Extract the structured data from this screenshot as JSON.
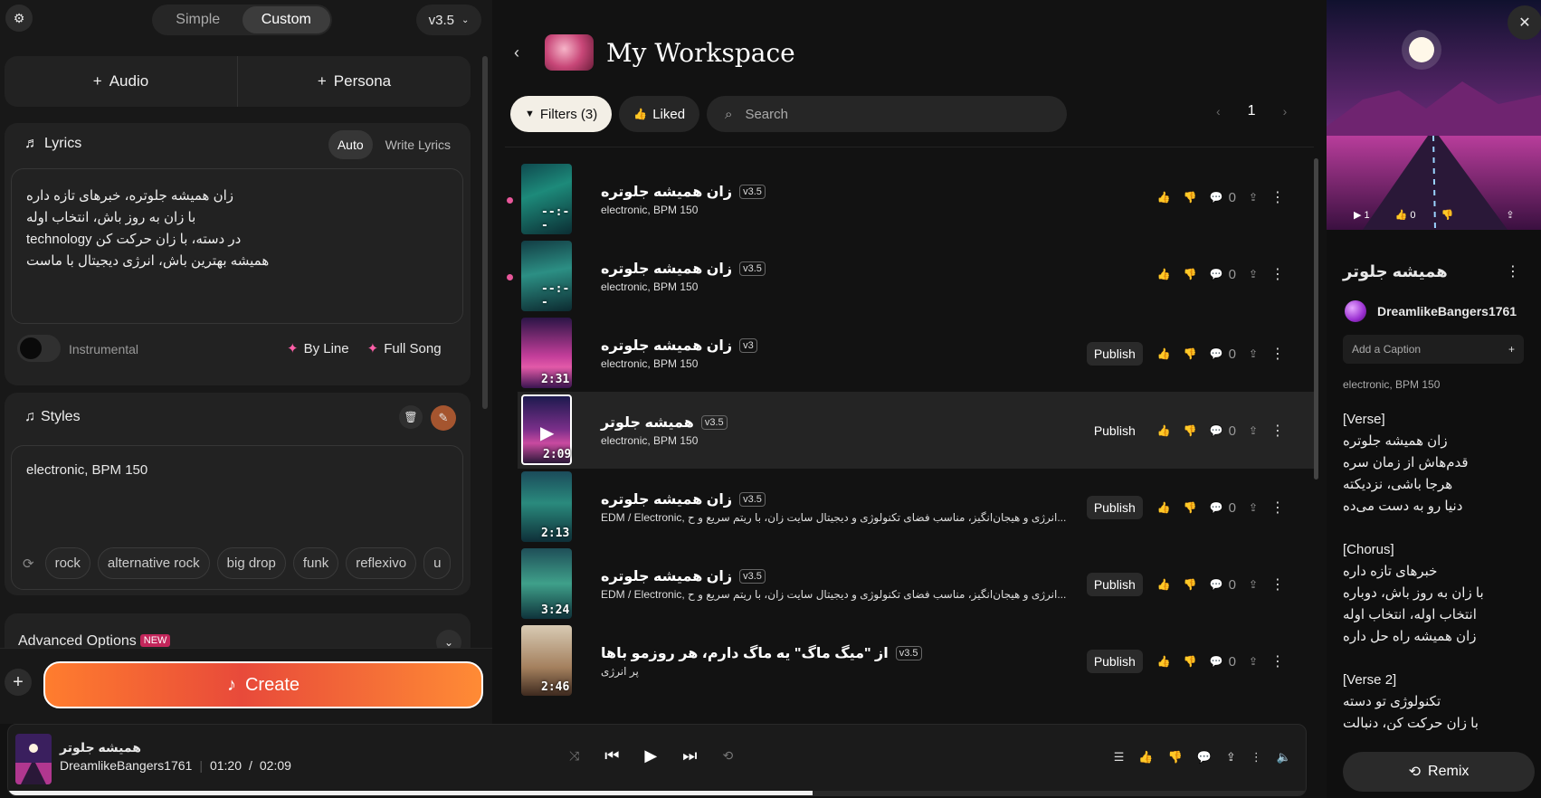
{
  "left": {
    "mode_tabs": [
      "Simple",
      "Custom"
    ],
    "active_mode": "Custom",
    "version": "v3.5",
    "add_audio": "Audio",
    "add_persona": "Persona",
    "lyrics": {
      "title": "Lyrics",
      "tab_auto": "Auto",
      "tab_write": "Write Lyrics",
      "lines": [
        "زان همیشه جلوتره، خبرهای تازه داره",
        "با زان به روز باش، انتخاب اوله",
        "technology در دسته، با زان حرکت کن",
        "همیشه بهترین باش، انرژی دیجیتال با ماست"
      ],
      "instrumental_label": "Instrumental",
      "by_line": "By Line",
      "full_song": "Full Song"
    },
    "styles": {
      "title": "Styles",
      "value": "electronic, BPM 150",
      "tags": [
        "rock",
        "alternative rock",
        "big drop",
        "funk",
        "reflexivo",
        "u"
      ]
    },
    "advanced": {
      "label": "Advanced Options",
      "badge": "NEW"
    },
    "create_label": "Create"
  },
  "center": {
    "title": "My Workspace",
    "filters_label": "Filters (3)",
    "liked_label": "Liked",
    "search_placeholder": "Search",
    "page": "1",
    "tracks": [
      {
        "title": "زان همیشه جلوتره",
        "version": "v3.5",
        "style": "electronic, BPM 150",
        "duration": "--:--",
        "publish": "",
        "comments": "0",
        "new": true,
        "selected": false,
        "art": "city"
      },
      {
        "title": "زان همیشه جلوتره",
        "version": "v3.5",
        "style": "electronic, BPM 150",
        "duration": "--:--",
        "publish": "",
        "comments": "0",
        "new": true,
        "selected": false,
        "art": "city2"
      },
      {
        "title": "زان همیشه جلوتره",
        "version": "v3",
        "style": "electronic, BPM 150",
        "duration": "2:31",
        "publish": "Publish",
        "comments": "0",
        "new": false,
        "selected": false,
        "art": "sunset"
      },
      {
        "title": "همیشه جلوتر",
        "version": "v3.5",
        "style": "electronic, BPM 150",
        "duration": "2:09",
        "publish": "Publish",
        "comments": "0",
        "new": false,
        "selected": true,
        "art": "road"
      },
      {
        "title": "زان همیشه جلوتره",
        "version": "v3.5",
        "style": "EDM / Electronic, انرژی و هیجان‌انگیز، مناسب فضای تکنولوژی و دیجیتال سایت زان، با ریتم سریع و ح...",
        "duration": "2:13",
        "publish": "Publish",
        "comments": "0",
        "new": false,
        "selected": false,
        "art": "skyline"
      },
      {
        "title": "زان همیشه جلوتره",
        "version": "v3.5",
        "style": "EDM / Electronic, انرژی و هیجان‌انگیز، مناسب فضای تکنولوژی و دیجیتال سایت زان، با ریتم سریع و ح...",
        "duration": "3:24",
        "publish": "Publish",
        "comments": "0",
        "new": false,
        "selected": false,
        "art": "skyline2"
      },
      {
        "title": "از \"میگ ماگ\" یه ماگ دارم، هر روزمو باها",
        "version": "v3.5",
        "style": "پر انرژی",
        "duration": "2:46",
        "publish": "Publish",
        "comments": "0",
        "new": false,
        "selected": false,
        "art": "mug"
      }
    ]
  },
  "right": {
    "plays": "1",
    "likes": "0",
    "title": "همیشه جلوتر",
    "author": "DreamlikeBangers1761",
    "caption_placeholder": "Add a Caption",
    "style": "electronic, BPM 150",
    "lyrics": [
      "[Verse]",
      "زان همیشه جلوتره",
      "قدم‌هاش از زمان سره",
      "هرجا باشی، نزدیکته",
      "دنیا رو به دست می‌ده",
      "",
      "[Chorus]",
      "خبرهای تازه داره",
      "با زان به روز باش، دوباره",
      "انتخاب اوله، انتخاب اوله",
      "زان همیشه راه حل داره",
      "",
      "[Verse 2]",
      "تکنولوژی تو دسته",
      "با زان حرکت کن، دنبالت"
    ],
    "remix_label": "Remix"
  },
  "player": {
    "title": "همیشه جلوتر",
    "artist": "DreamlikeBangers1761",
    "current": "01:20",
    "total": "02:09",
    "progress_fraction": 0.62
  }
}
